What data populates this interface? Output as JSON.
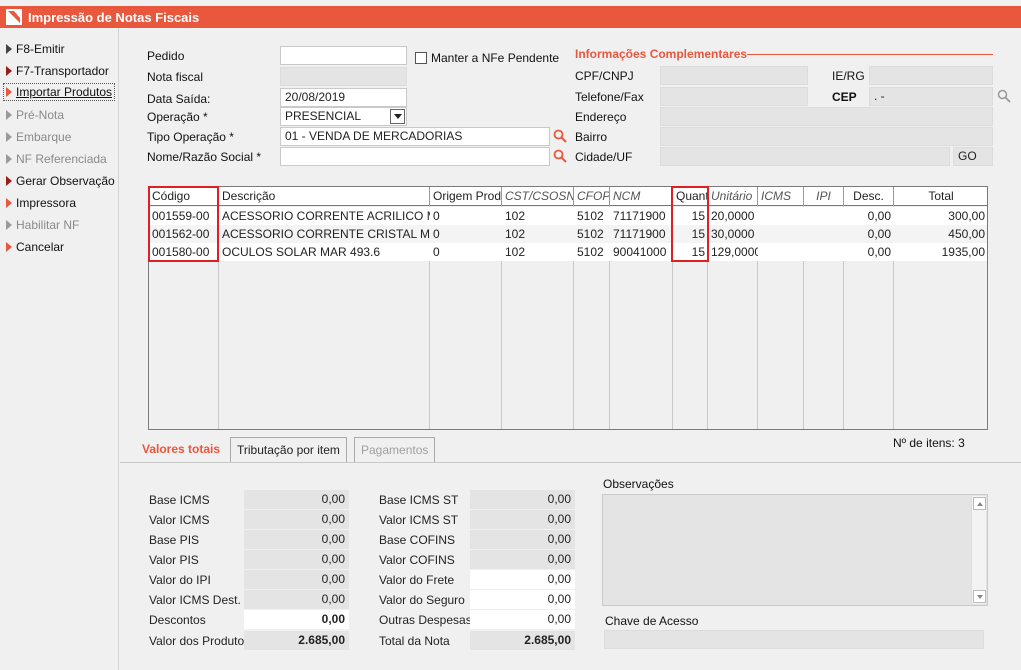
{
  "window": {
    "title": "Impressão de Notas Fiscais"
  },
  "sidebar": {
    "items": [
      {
        "label": "F8-Emitir"
      },
      {
        "label": "F7-Transportador"
      },
      {
        "label": "Importar Produtos"
      },
      {
        "label": "Pré-Nota"
      },
      {
        "label": "Embarque"
      },
      {
        "label": "NF Referenciada"
      },
      {
        "label": "Gerar Observação"
      },
      {
        "label": "Impressora"
      },
      {
        "label": "Habilitar NF"
      },
      {
        "label": "Cancelar"
      }
    ]
  },
  "form": {
    "pedido_label": "Pedido",
    "pedido_value": "",
    "manter_label": "Manter a NFe Pendente",
    "nota_label": "Nota fiscal",
    "nota_value": "",
    "data_label": "Data Saída:",
    "data_value": "20/08/2019",
    "operacao_label": "Operação *",
    "operacao_value": "PRESENCIAL",
    "tipo_label": "Tipo Operação *",
    "tipo_value": "01 - VENDA DE MERCADORIAS",
    "nome_label": "Nome/Razão Social *",
    "nome_value": ""
  },
  "info": {
    "title": "Informações Complementares",
    "cpf_label": "CPF/CNPJ",
    "ie_label": "IE/RG",
    "tel_label": "Telefone/Fax",
    "cep_label": "CEP",
    "cep_value": ". -",
    "end_label": "Endereço",
    "bairro_label": "Bairro",
    "cidade_label": "Cidade/UF",
    "uf_value": "GO"
  },
  "grid": {
    "headers": [
      "Código",
      "Descrição",
      "Origem Prod",
      "CST/CSOSN",
      "CFOP",
      "NCM",
      "Quant",
      "Unitário",
      "ICMS",
      "IPI",
      "Desc.",
      "Total"
    ],
    "rows": [
      [
        "001559-00",
        "ACESSORIO CORRENTE ACRILICO MAR",
        "0",
        "102",
        "5102",
        "71171900",
        "15",
        "20,0000",
        "",
        "",
        "0,00",
        "300,00"
      ],
      [
        "001562-00",
        "ACESSORIO CORRENTE  CRISTAL MAR",
        "0",
        "102",
        "5102",
        "71171900",
        "15",
        "30,0000",
        "",
        "",
        "0,00",
        "450,00"
      ],
      [
        "001580-00",
        "OCULOS SOLAR  MAR 493.6",
        "0",
        "102",
        "5102",
        "90041000",
        "15",
        "129,0000",
        "",
        "",
        "0,00",
        "1935,00"
      ]
    ],
    "item_count": "Nº de itens: 3"
  },
  "tabs": [
    "Valores totais",
    "Tributação por item",
    "Pagamentos"
  ],
  "totals_left": [
    {
      "label": "Base ICMS",
      "value": "0,00"
    },
    {
      "label": "Valor ICMS",
      "value": "0,00"
    },
    {
      "label": "Base PIS",
      "value": "0,00"
    },
    {
      "label": "Valor PIS",
      "value": "0,00"
    },
    {
      "label": "Valor do IPI",
      "value": "0,00"
    },
    {
      "label": "Valor ICMS Dest.",
      "value": "0,00"
    },
    {
      "label": "Descontos",
      "value": "0,00"
    },
    {
      "label": "Valor dos Produto",
      "value": "2.685,00"
    }
  ],
  "totals_right": [
    {
      "label": "Base ICMS ST",
      "value": "0,00"
    },
    {
      "label": "Valor ICMS ST",
      "value": "0,00"
    },
    {
      "label": "Base COFINS",
      "value": "0,00"
    },
    {
      "label": "Valor COFINS",
      "value": "0,00"
    },
    {
      "label": "Valor do Frete",
      "value": "0,00"
    },
    {
      "label": "Valor do Seguro",
      "value": "0,00"
    },
    {
      "label": "Outras Despesas",
      "value": "0,00"
    },
    {
      "label": "Total da Nota",
      "value": "2.685,00"
    }
  ],
  "observacoes_label": "Observações",
  "chave_label": "Chave de Acesso",
  "colors": {
    "accent": "#e9573d",
    "highlight": "#e02020"
  }
}
